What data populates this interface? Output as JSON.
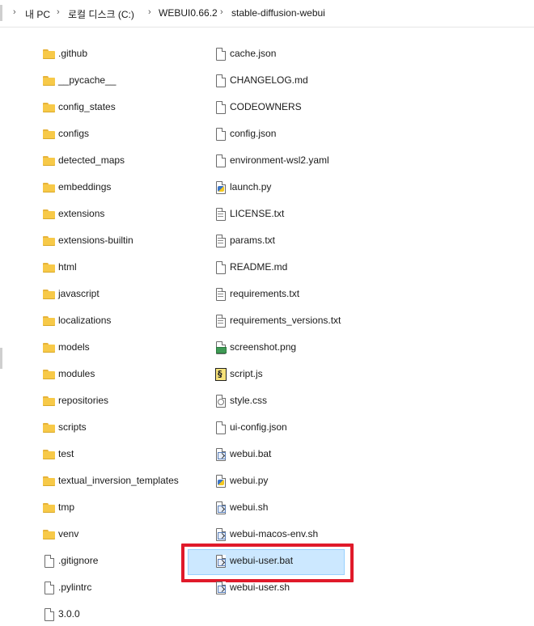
{
  "address_bar": {
    "crumbs": [
      "내 PC",
      "로컬 디스크 (C:)",
      "WEBUI0.66.2",
      "stable-diffusion-webui"
    ]
  },
  "files": [
    {
      "name": ".github",
      "type": "folder"
    },
    {
      "name": "__pycache__",
      "type": "folder"
    },
    {
      "name": "config_states",
      "type": "folder"
    },
    {
      "name": "configs",
      "type": "folder"
    },
    {
      "name": "detected_maps",
      "type": "folder"
    },
    {
      "name": "embeddings",
      "type": "folder"
    },
    {
      "name": "extensions",
      "type": "folder"
    },
    {
      "name": "extensions-builtin",
      "type": "folder"
    },
    {
      "name": "html",
      "type": "folder"
    },
    {
      "name": "javascript",
      "type": "folder"
    },
    {
      "name": "localizations",
      "type": "folder"
    },
    {
      "name": "models",
      "type": "folder"
    },
    {
      "name": "modules",
      "type": "folder"
    },
    {
      "name": "repositories",
      "type": "folder"
    },
    {
      "name": "scripts",
      "type": "folder"
    },
    {
      "name": "test",
      "type": "folder"
    },
    {
      "name": "textual_inversion_templates",
      "type": "folder"
    },
    {
      "name": "tmp",
      "type": "folder"
    },
    {
      "name": "venv",
      "type": "folder"
    },
    {
      "name": ".gitignore",
      "type": "file"
    },
    {
      "name": ".pylintrc",
      "type": "file"
    },
    {
      "name": "3.0.0",
      "type": "file"
    },
    {
      "name": "cache.json",
      "type": "file"
    },
    {
      "name": "CHANGELOG.md",
      "type": "file"
    },
    {
      "name": "CODEOWNERS",
      "type": "file"
    },
    {
      "name": "config.json",
      "type": "file"
    },
    {
      "name": "environment-wsl2.yaml",
      "type": "file"
    },
    {
      "name": "launch.py",
      "type": "py"
    },
    {
      "name": "LICENSE.txt",
      "type": "txt"
    },
    {
      "name": "params.txt",
      "type": "txt"
    },
    {
      "name": "README.md",
      "type": "file"
    },
    {
      "name": "requirements.txt",
      "type": "txt"
    },
    {
      "name": "requirements_versions.txt",
      "type": "txt"
    },
    {
      "name": "screenshot.png",
      "type": "png"
    },
    {
      "name": "script.js",
      "type": "js"
    },
    {
      "name": "style.css",
      "type": "css"
    },
    {
      "name": "ui-config.json",
      "type": "file"
    },
    {
      "name": "webui.bat",
      "type": "bat"
    },
    {
      "name": "webui.py",
      "type": "py"
    },
    {
      "name": "webui.sh",
      "type": "bat"
    },
    {
      "name": "webui-macos-env.sh",
      "type": "bat"
    },
    {
      "name": "webui-user.bat",
      "type": "bat",
      "selected": true
    },
    {
      "name": "webui-user.sh",
      "type": "bat"
    }
  ],
  "colors": {
    "selection": "#cce8ff",
    "highlight_box": "#e01a2a",
    "folder": "#f7c948"
  }
}
